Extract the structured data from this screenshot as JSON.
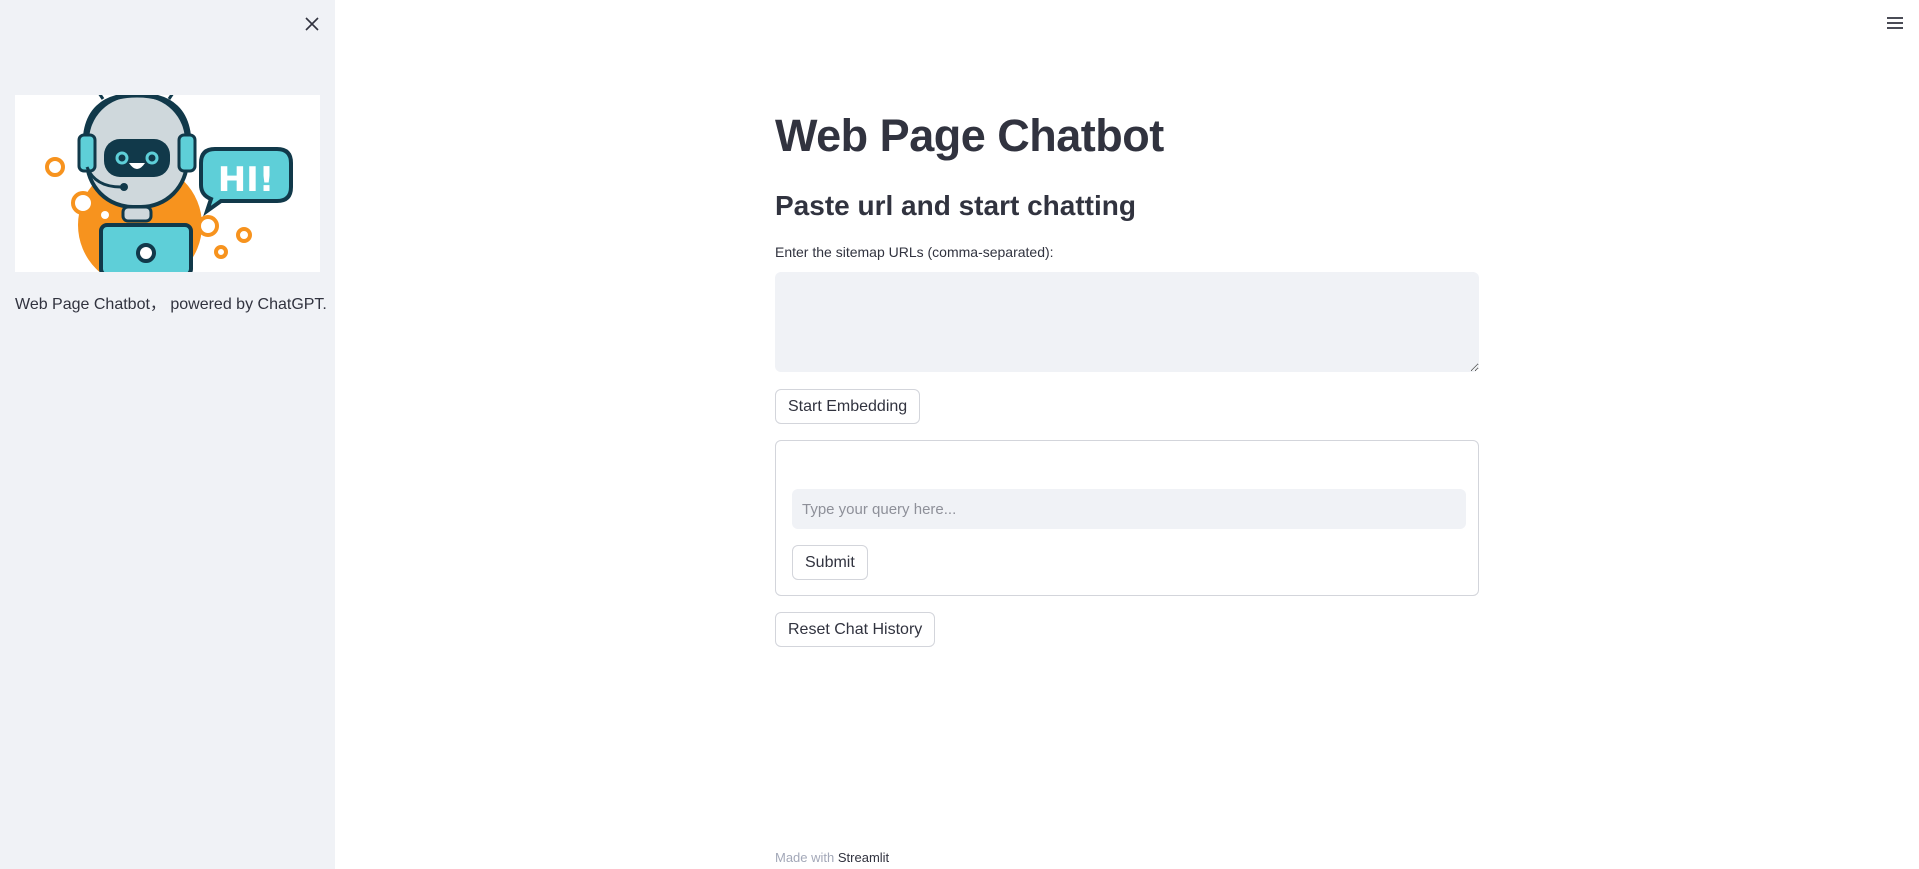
{
  "sidebar": {
    "close_icon": "close-icon",
    "caption": "Web Page Chatbot，  powered by ChatGPT.",
    "image": {
      "speech_text": "HI!",
      "colors": {
        "orange": "#f7931e",
        "teal": "#5ecfd8",
        "dark": "#11394a",
        "grey": "#cfd8dc"
      }
    }
  },
  "header": {
    "menu_icon": "hamburger-menu-icon"
  },
  "main": {
    "title": "Web Page Chatbot",
    "subtitle": "Paste url and start chatting",
    "urls_label": "Enter the sitemap URLs (comma-separated):",
    "urls_value": "",
    "embed_button": "Start Embedding",
    "query_placeholder": "Type your query here...",
    "query_value": "",
    "submit_button": "Submit",
    "reset_button": "Reset Chat History"
  },
  "footer": {
    "prefix": "Made with ",
    "brand": "Streamlit"
  },
  "colors": {
    "sidebar_bg": "#f0f2f6",
    "text": "#31333f",
    "input_bg": "#f0f2f6",
    "border": "#d3d5db"
  }
}
